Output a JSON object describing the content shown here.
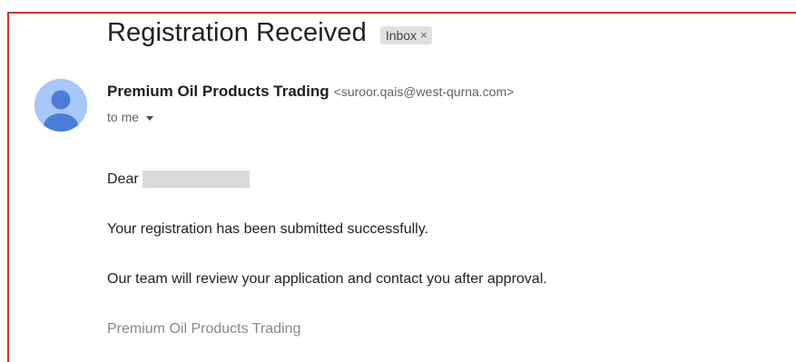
{
  "email": {
    "subject": "Registration Received",
    "label": {
      "name": "Inbox",
      "remove_symbol": "×"
    },
    "sender": {
      "name": "Premium Oil Products Trading",
      "email": "<suroor.qais@west-qurna.com>"
    },
    "recipient_text": "to me",
    "body": {
      "greeting": "Dear",
      "line_1": "Your registration has been submitted successfully.",
      "line_2": "Our team will review your application and contact you after approval.",
      "signature": "Premium Oil Products Trading"
    }
  },
  "colors": {
    "border": "#d93025",
    "avatar_bg": "#a8c7fa",
    "avatar_fg": "#4a7dd8",
    "chip_bg": "#e0e0e0",
    "redaction": "#d9d9d9"
  },
  "icons": {
    "avatar": "person-avatar-icon",
    "recipient_toggle": "caret-down-icon",
    "label_remove": "close-icon"
  }
}
